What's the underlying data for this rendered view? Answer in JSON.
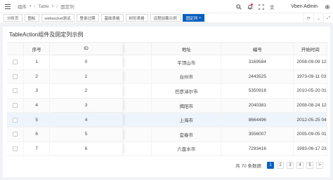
{
  "header": {
    "breadcrumb": [
      "组件",
      "Table",
      "固定列"
    ],
    "username": "Vben Admin"
  },
  "tabs": [
    {
      "label": "分析页",
      "active": false
    },
    {
      "label": "图标",
      "active": false
    },
    {
      "label": "websocket测试",
      "active": false
    },
    {
      "label": "登录过期",
      "active": false
    },
    {
      "label": "基础表格",
      "active": false
    },
    {
      "label": "树形表格",
      "active": false
    },
    {
      "label": "远程加载示例",
      "active": false
    },
    {
      "label": "固定列",
      "active": true
    }
  ],
  "card": {
    "title": "TableAction组件及固定列示例"
  },
  "table": {
    "columns": [
      "序号",
      "ID",
      "地址",
      "编号",
      "开始时间"
    ],
    "rows": [
      {
        "no": "1",
        "id": "0",
        "addr": "平顶山市",
        "code": "3169584",
        "time": "2008-09-09 12:1"
      },
      {
        "no": "2",
        "id": "1",
        "addr": "台州市",
        "code": "2443525",
        "time": "1973-09-11 03:2"
      },
      {
        "no": "3",
        "id": "2",
        "addr": "巴彦淖尔市",
        "code": "5350918",
        "time": "2010-05-20 01:0"
      },
      {
        "no": "4",
        "id": "3",
        "addr": "揭阳市",
        "code": "2040381",
        "time": "2008-08-24 12:5"
      },
      {
        "no": "5",
        "id": "4",
        "addr": "上海市",
        "code": "8664496",
        "time": "2012-05-25 04:1"
      },
      {
        "no": "6",
        "id": "5",
        "addr": "宜春市",
        "code": "3556007",
        "time": "2005-09-05 01:2"
      },
      {
        "no": "7",
        "id": "6",
        "addr": "六盘水市",
        "code": "7293416",
        "time": "1993-06-17 23:0"
      }
    ]
  },
  "pagination": {
    "total": "共 70 条数据",
    "pages": [
      "1",
      "2",
      "3",
      "4",
      "5"
    ],
    "current": "1",
    "next": ">",
    "prev": "<"
  },
  "colors": {
    "accent": "#0960bd"
  }
}
